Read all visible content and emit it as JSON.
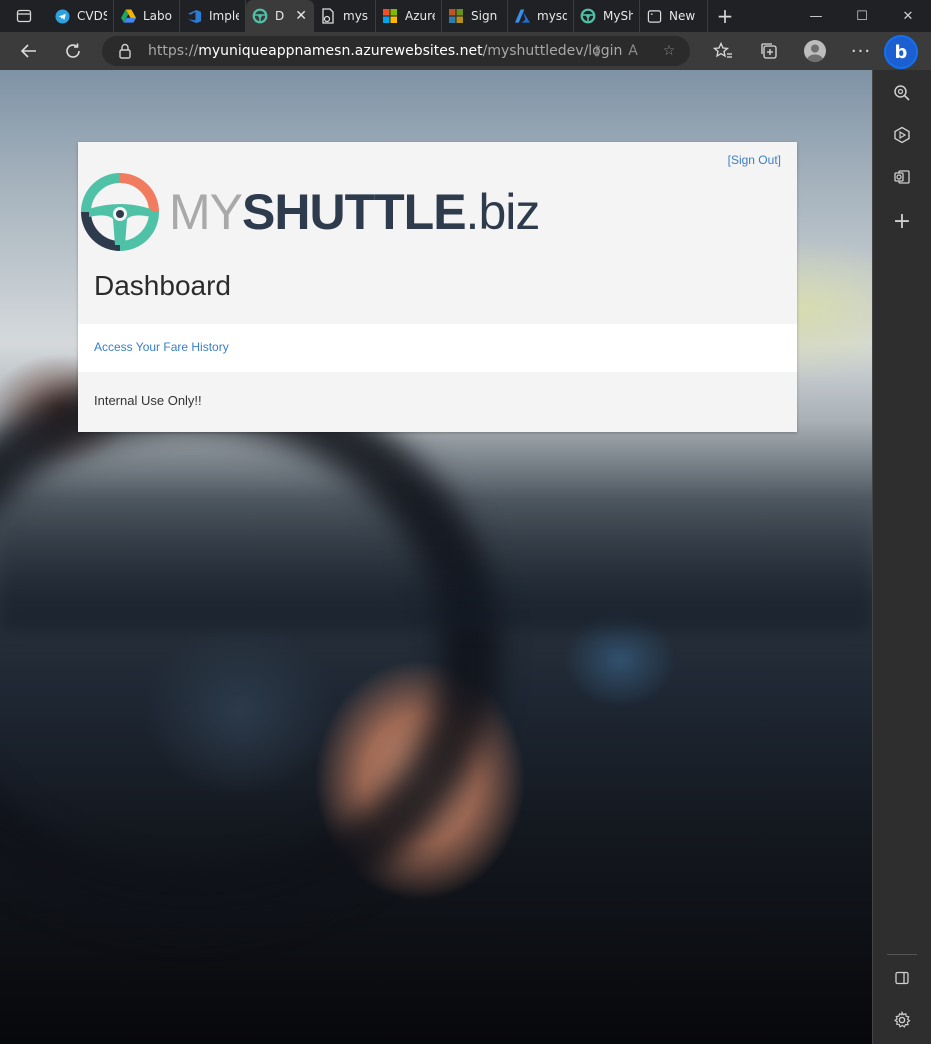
{
  "browser": {
    "tabs": [
      {
        "title": "CVDS",
        "icon": "telegram-icon",
        "color": "#2aa3e0"
      },
      {
        "title": "Labor",
        "icon": "google-drive-icon",
        "color": "#f2b400"
      },
      {
        "title": "Imple",
        "icon": "azure-devops-icon",
        "color": "#2b7cd3"
      },
      {
        "title": "D",
        "icon": "myshuttle-icon",
        "color": "#4fc1a6",
        "active": true
      },
      {
        "title": "mysh",
        "icon": "document-icon",
        "color": "#dddddd"
      },
      {
        "title": "Azure",
        "icon": "microsoft-icon",
        "color": "#f25022"
      },
      {
        "title": "Sign",
        "icon": "microsoft-icon",
        "color": "#737373"
      },
      {
        "title": "mysq",
        "icon": "azure-icon",
        "color": "#3c8ee8"
      },
      {
        "title": "MySh",
        "icon": "myshuttle-icon",
        "color": "#4fc1a6"
      },
      {
        "title": "New",
        "icon": "new-tab-icon",
        "color": "#dddddd"
      }
    ],
    "address": {
      "scheme": "https://",
      "host": "myuniqueappnamesn.azurewebsites.net",
      "path": "/myshuttledev/login"
    },
    "bing_label": "b"
  },
  "page": {
    "sign_out": "[Sign Out]",
    "logo": {
      "my": "MY",
      "shuttle": "SHUTTLE",
      "biz": ".biz"
    },
    "title": "Dashboard",
    "fare_link": "Access Your Fare History",
    "note": "Internal Use Only!!"
  },
  "colors": {
    "link": "#3a7fc4",
    "logo_dark": "#2e3b4d",
    "logo_teal": "#4fc1a6",
    "logo_coral": "#f07b5e"
  }
}
